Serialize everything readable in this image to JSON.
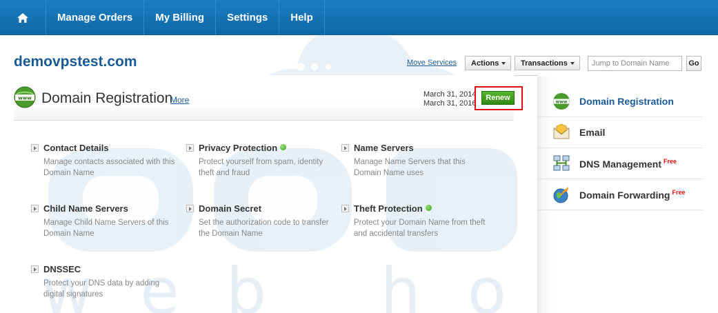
{
  "nav": {
    "home_icon": "home-icon",
    "items": [
      "Manage Orders",
      "My Billing",
      "Settings",
      "Help"
    ]
  },
  "header": {
    "domain": "demovpstest.com",
    "move_services": "Move Services",
    "actions_label": "Actions",
    "transactions_label": "Transactions",
    "jump_placeholder": "Jump to Domain Name",
    "go_label": "Go"
  },
  "registration": {
    "title": "Domain Registration",
    "more_label": "More",
    "date_registered": "March 31, 2014",
    "date_expires": "March 31, 2016",
    "renew_label": "Renew"
  },
  "features": [
    {
      "title": "Contact Details",
      "desc": "Manage contacts associated with this Domain Name",
      "status": ""
    },
    {
      "title": "Privacy Protection",
      "desc": "Protect yourself from spam, identity theft and fraud",
      "status": "active"
    },
    {
      "title": "Name Servers",
      "desc": "Manage Name Servers that this Domain Name uses",
      "status": ""
    },
    {
      "title": "Child Name Servers",
      "desc": "Manage Child Name Servers of this Domain Name",
      "status": ""
    },
    {
      "title": "Domain Secret",
      "desc": "Set the authorization code to transfer the Domain Name",
      "status": ""
    },
    {
      "title": "Theft Protection",
      "desc": "Protect your Domain Name from theft and accidental transfers",
      "status": "active"
    },
    {
      "title": "DNSSEC",
      "desc": "Protect your DNS data by adding digital signatures",
      "status": ""
    }
  ],
  "sidebar": {
    "items": [
      {
        "label": "Domain Registration",
        "badge": "",
        "icon": "globe-icon"
      },
      {
        "label": "Email",
        "badge": "",
        "icon": "envelope-icon"
      },
      {
        "label": "DNS Management",
        "badge": "Free",
        "icon": "network-icon"
      },
      {
        "label": "Domain Forwarding",
        "badge": "Free",
        "icon": "forward-globe-icon"
      }
    ]
  },
  "colors": {
    "nav_bg": "#1274b6",
    "title_blue": "#1a5a96",
    "renew_green": "#3f9a1b",
    "highlight_red": "#e01010",
    "status_green": "#2e9e12"
  }
}
